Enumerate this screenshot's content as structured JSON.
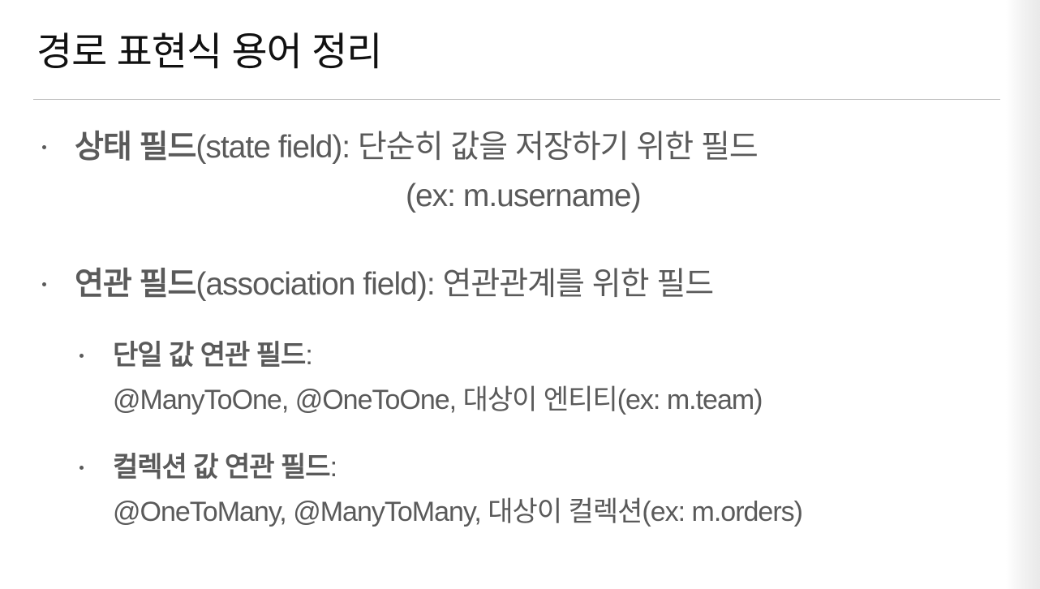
{
  "slide": {
    "title": "경로 표현식 용어 정리"
  },
  "bullets": {
    "state": {
      "term": "상태 필드",
      "paren": "(state field)",
      "desc": ": 단순히 값을 저장하기 위한 필드",
      "example": "(ex: m.username)"
    },
    "association": {
      "term": "연관 필드",
      "paren": "(association field)",
      "desc": ": 연관관계를 위한 필드",
      "sub": {
        "single": {
          "term": "단일 값 연관 필드",
          "colon": ":",
          "desc": "@ManyToOne, @OneToOne, 대상이 엔티티(ex: m.team)"
        },
        "collection": {
          "term": "컬렉션 값 연관 필드",
          "colon": ":",
          "desc": "@OneToMany, @ManyToMany, 대상이 컬렉션(ex: m.orders)"
        }
      }
    }
  }
}
